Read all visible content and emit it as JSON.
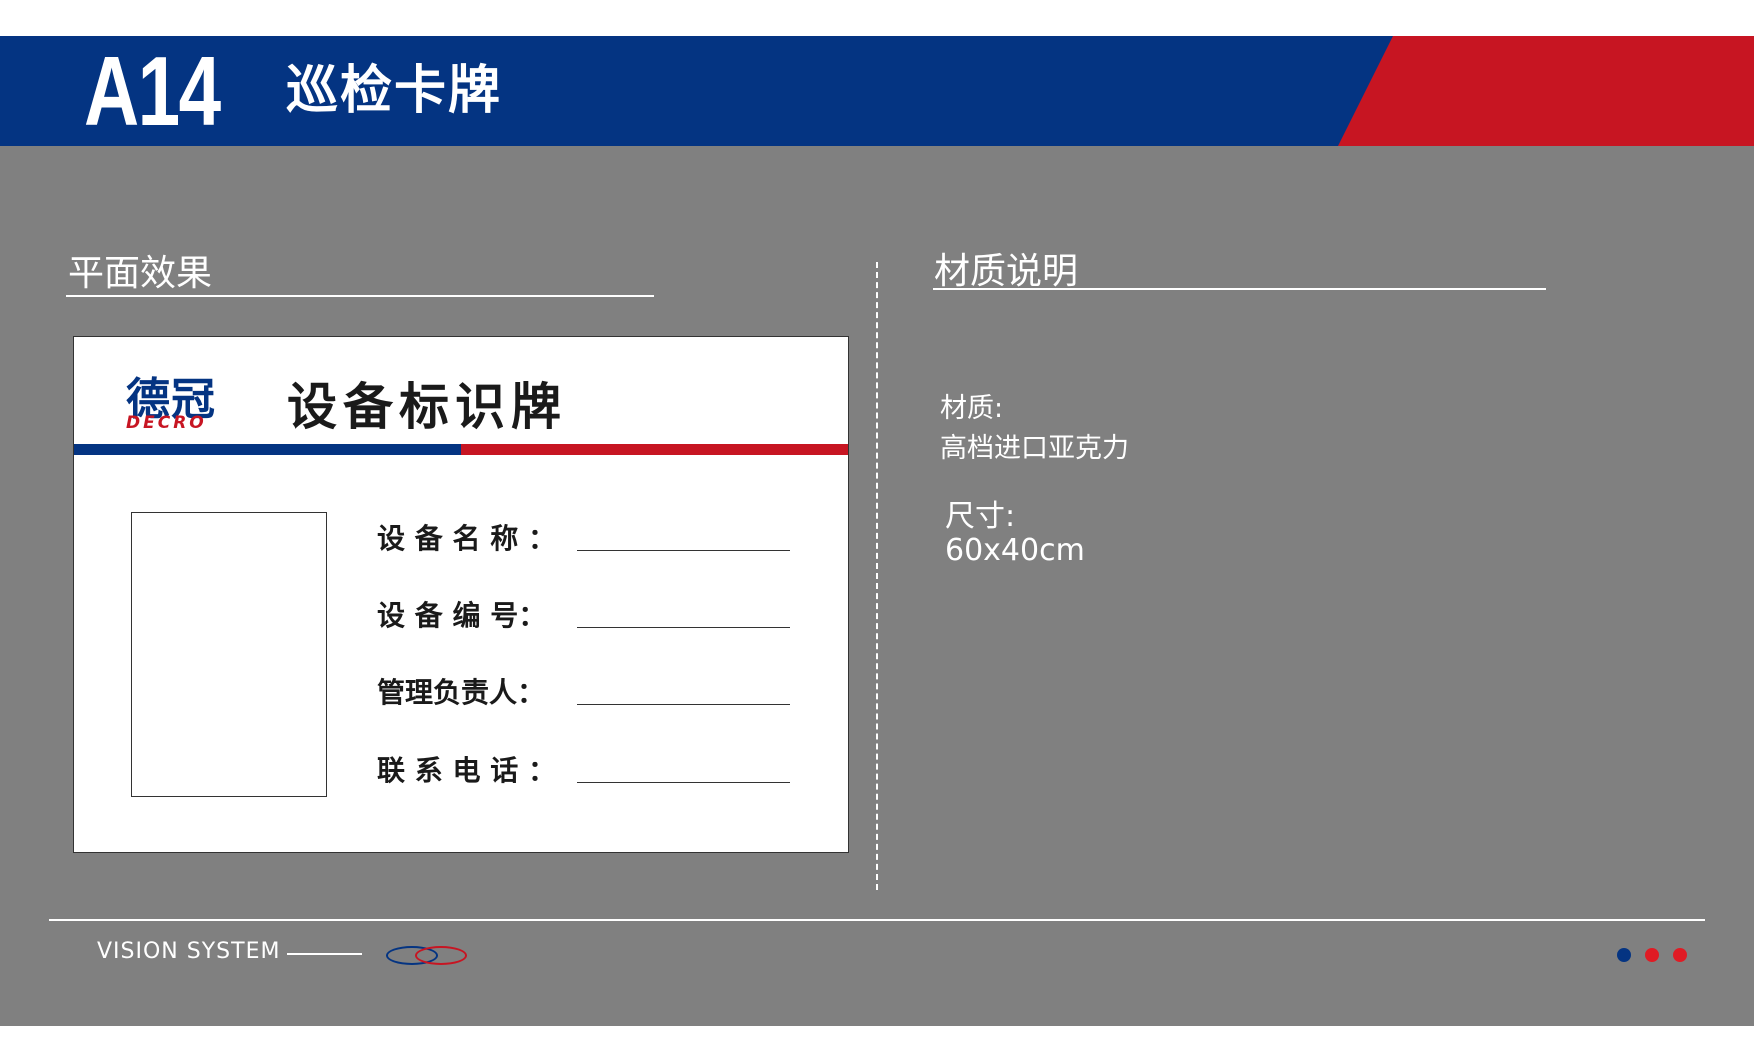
{
  "header": {
    "code": "A14",
    "title": "巡检卡牌"
  },
  "sections": {
    "left_title": "平面效果",
    "right_title": "材质说明"
  },
  "sign": {
    "logo_cn": "德冠",
    "logo_en": "DECRO",
    "title": "设备标识牌",
    "fields": [
      "设 备 名 称 ：",
      "设 备 编 号：",
      "管理负责人：",
      "联 系 电 话 ："
    ]
  },
  "material": {
    "material_label": "材质:",
    "material_value": "高档进口亚克力",
    "size_label": "尺寸:",
    "size_value": "60x40cm"
  },
  "footer": {
    "text": "VISION  SYSTEM"
  },
  "colors": {
    "brand_blue": "#043482",
    "brand_red": "#c71522",
    "background_gray": "#808080"
  }
}
